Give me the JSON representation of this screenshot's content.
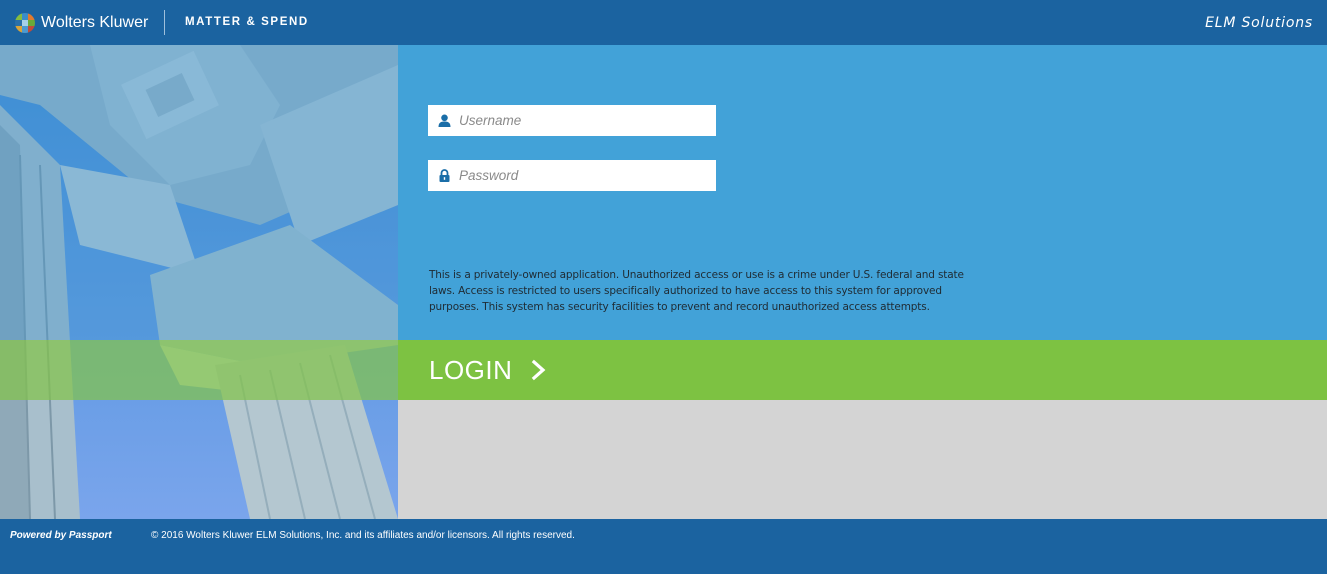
{
  "header": {
    "brand": "Wolters Kluwer",
    "product": "MATTER & SPEND",
    "right_title": "ELM Solutions"
  },
  "form": {
    "username_placeholder": "Username",
    "password_placeholder": "Password",
    "notice": "This is a privately-owned application. Unauthorized access or use is a crime under U.S. federal and state laws. Access is restricted to users specifically authorized to have access to this system for approved purposes. This system has security facilities to prevent and record unauthorized access attempts.",
    "login_label": "LOGIN"
  },
  "footer": {
    "powered_by": "Powered by Passport",
    "copyright": "© 2016 Wolters Kluwer ELM Solutions, Inc. and its affiliates and/or licensors. All rights reserved."
  },
  "icons": {
    "logo": "wolters-kluwer-logo",
    "user": "user-icon",
    "lock": "lock-icon",
    "chevron": "chevron-right-icon"
  },
  "colors": {
    "header": "#1b63a0",
    "form_panel": "#42a2d8",
    "login_bar": "#7dc242",
    "bottom_panel": "#d4d4d4"
  }
}
